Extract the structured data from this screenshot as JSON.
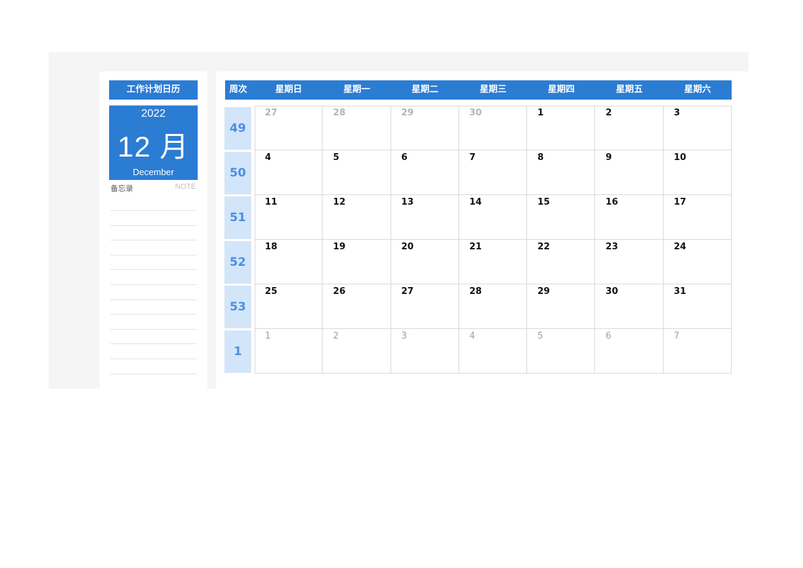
{
  "sidebar": {
    "title": "工作计划日历",
    "year": "2022",
    "month": "12 月",
    "month_en": "December",
    "memo_label": "备忘录",
    "note_label": "NOTE",
    "note_line_count": 12
  },
  "calendar": {
    "week_header": "周次",
    "weekdays": [
      "星期日",
      "星期一",
      "星期二",
      "星期三",
      "星期四",
      "星期五",
      "星期六"
    ],
    "weeks": [
      {
        "week": "49",
        "days": [
          {
            "d": "27",
            "type": "prev"
          },
          {
            "d": "28",
            "type": "prev"
          },
          {
            "d": "29",
            "type": "prev"
          },
          {
            "d": "30",
            "type": "prev"
          },
          {
            "d": "1",
            "type": "cur"
          },
          {
            "d": "2",
            "type": "cur"
          },
          {
            "d": "3",
            "type": "cur"
          }
        ]
      },
      {
        "week": "50",
        "days": [
          {
            "d": "4",
            "type": "cur"
          },
          {
            "d": "5",
            "type": "cur"
          },
          {
            "d": "6",
            "type": "cur"
          },
          {
            "d": "7",
            "type": "cur"
          },
          {
            "d": "8",
            "type": "cur"
          },
          {
            "d": "9",
            "type": "cur"
          },
          {
            "d": "10",
            "type": "cur"
          }
        ]
      },
      {
        "week": "51",
        "days": [
          {
            "d": "11",
            "type": "cur"
          },
          {
            "d": "12",
            "type": "cur"
          },
          {
            "d": "13",
            "type": "cur"
          },
          {
            "d": "14",
            "type": "cur"
          },
          {
            "d": "15",
            "type": "cur"
          },
          {
            "d": "16",
            "type": "cur"
          },
          {
            "d": "17",
            "type": "cur"
          }
        ]
      },
      {
        "week": "52",
        "days": [
          {
            "d": "18",
            "type": "cur"
          },
          {
            "d": "19",
            "type": "cur"
          },
          {
            "d": "20",
            "type": "cur"
          },
          {
            "d": "21",
            "type": "cur"
          },
          {
            "d": "22",
            "type": "cur"
          },
          {
            "d": "23",
            "type": "cur"
          },
          {
            "d": "24",
            "type": "cur"
          }
        ]
      },
      {
        "week": "53",
        "days": [
          {
            "d": "25",
            "type": "cur"
          },
          {
            "d": "26",
            "type": "cur"
          },
          {
            "d": "27",
            "type": "cur"
          },
          {
            "d": "28",
            "type": "cur"
          },
          {
            "d": "29",
            "type": "cur"
          },
          {
            "d": "30",
            "type": "cur"
          },
          {
            "d": "31",
            "type": "cur"
          }
        ]
      },
      {
        "week": "1",
        "days": [
          {
            "d": "1",
            "type": "next"
          },
          {
            "d": "2",
            "type": "next"
          },
          {
            "d": "3",
            "type": "next"
          },
          {
            "d": "4",
            "type": "next"
          },
          {
            "d": "5",
            "type": "next"
          },
          {
            "d": "6",
            "type": "next"
          },
          {
            "d": "7",
            "type": "next"
          }
        ]
      }
    ]
  },
  "colors": {
    "accent": "#2b7cd3",
    "week_bg": "#d3e5f8",
    "week_text": "#4a8fe0",
    "sheet_bg": "#f5f5f5"
  }
}
